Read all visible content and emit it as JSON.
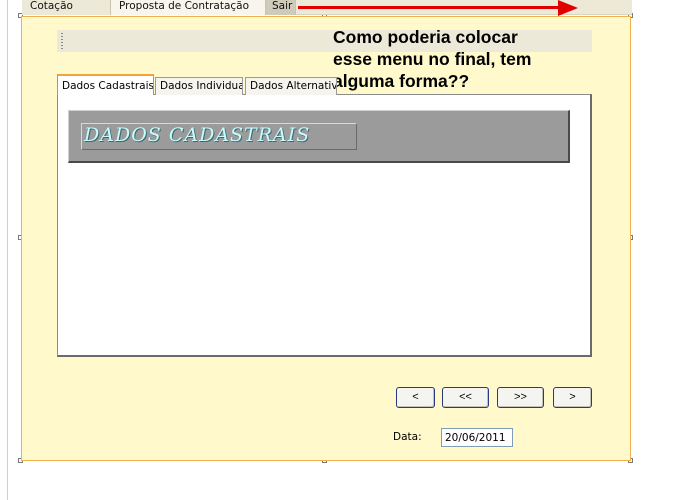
{
  "menu": {
    "items": [
      {
        "label": "Cotação"
      },
      {
        "label": "Proposta de Contratação"
      },
      {
        "label": "Sair"
      }
    ]
  },
  "annotation": {
    "lines": [
      "Como poderia colocar",
      "esse menu no final, tem",
      "alguma forma??"
    ],
    "arrow_color": "#e00000"
  },
  "tabs": [
    {
      "label": "Dados Cadastrais",
      "active": true
    },
    {
      "label": "Dados Individual",
      "active": false
    },
    {
      "label": "Dados Alternativos",
      "active": false
    }
  ],
  "content": {
    "header_title": "DADOS CADASTRAIS"
  },
  "nav": {
    "prev_label": "<",
    "first_label": "<<",
    "last_label": ">>",
    "next_label": ">"
  },
  "date": {
    "label": "Data:",
    "value": "20/06/2011"
  },
  "colors": {
    "panel_bg": "#fff9cc",
    "panel_border": "#f0b050",
    "active_tab_accent": "#f2a33a",
    "header_box": "#9b9b9b"
  }
}
